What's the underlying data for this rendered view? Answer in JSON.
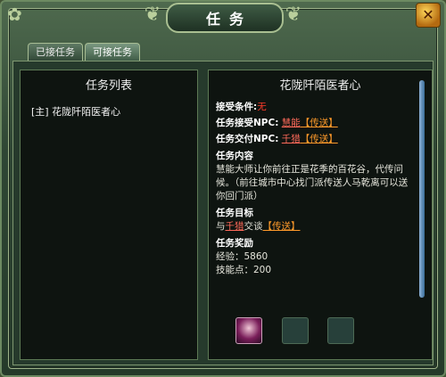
{
  "window": {
    "title": "任务"
  },
  "tabs": [
    {
      "label": "已接任务",
      "active": false
    },
    {
      "label": "可接任务",
      "active": true
    }
  ],
  "quest_list": {
    "title": "任务列表",
    "items": [
      {
        "label": "[主] 花陇阡陌医者心"
      }
    ]
  },
  "quest_detail": {
    "title": "花陇阡陌医者心",
    "accept_condition_label": "接受条件:",
    "accept_condition_value": "无",
    "accept_npc_label": "任务接受NPC:",
    "accept_npc_name": "慧能",
    "accept_npc_teleport": "【传送】",
    "turnin_npc_label": "任务交付NPC:",
    "turnin_npc_name": "千猎",
    "turnin_npc_teleport": "【传送】",
    "content_label": "任务内容",
    "content_text": "慧能大师让你前往正是花季的百花谷，代传问候。（前往城市中心找门派传送人马乾离可以送你回门派）",
    "goal_label": "任务目标",
    "goal_prefix": "与",
    "goal_npc": "千猎",
    "goal_suffix": "交谈",
    "goal_teleport": "【传送】",
    "reward_label": "任务奖励",
    "reward_exp": "经验：5860",
    "reward_skill": "技能点：200"
  },
  "rewards": [
    {
      "icon": "boots-item-icon",
      "filled": true
    },
    {
      "icon": "empty-slot",
      "filled": false
    },
    {
      "icon": "empty-slot",
      "filled": false
    }
  ],
  "colors": {
    "accent": "#ff3b2a",
    "link": "#ff6a5a",
    "teleport": "#ff9a2a"
  }
}
